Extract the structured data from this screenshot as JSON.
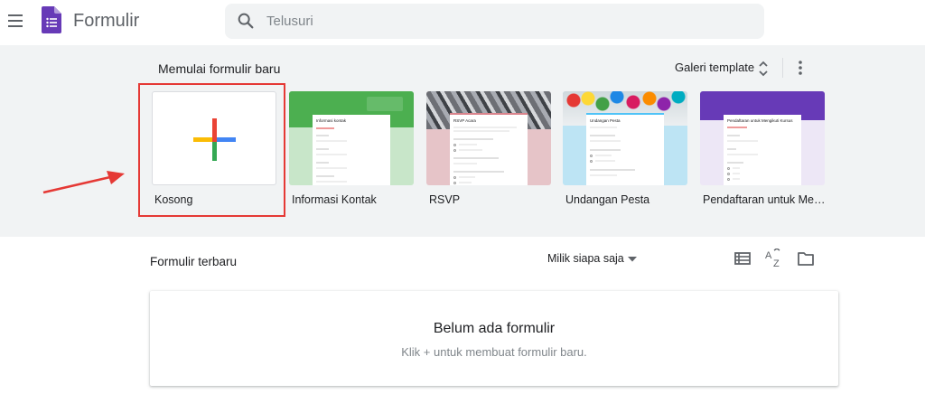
{
  "header": {
    "app_title": "Formulir",
    "search_placeholder": "Telusuri",
    "search_value": ""
  },
  "start_section": {
    "title": "Memulai formulir baru",
    "gallery_label": "Galeri template",
    "templates": [
      {
        "label": "Kosong"
      },
      {
        "label": "Informasi Kontak",
        "sheet_title": "Informasi kontak"
      },
      {
        "label": "RSVP",
        "sheet_title": "RSVP Acara"
      },
      {
        "label": "Undangan Pesta",
        "sheet_title": "Undangan Pesta"
      },
      {
        "label": "Pendaftaran untuk Me…",
        "sheet_title": "Pendaftaran untuk Mengikuti Kursus"
      }
    ]
  },
  "recent_section": {
    "title": "Formulir terbaru",
    "owner_filter": "Milik siapa saja",
    "empty_title": "Belum ada formulir",
    "empty_subtitle": "Klik + untuk membuat formulir baru."
  },
  "colors": {
    "forms_purple": "#673ab7",
    "highlight_red": "#e53935",
    "contact_green": "#4caf50",
    "rsvp_red": "#d9848c",
    "party_blue": "#bde4f4",
    "course_purple": "#673ab7"
  },
  "icons": [
    "menu-icon",
    "forms-logo-icon",
    "search-icon",
    "unfold-icon",
    "more-vert-icon",
    "plus-icon",
    "list-view-icon",
    "sort-az-icon",
    "folder-icon",
    "dropdown-caret-icon",
    "arrow-annotation"
  ]
}
